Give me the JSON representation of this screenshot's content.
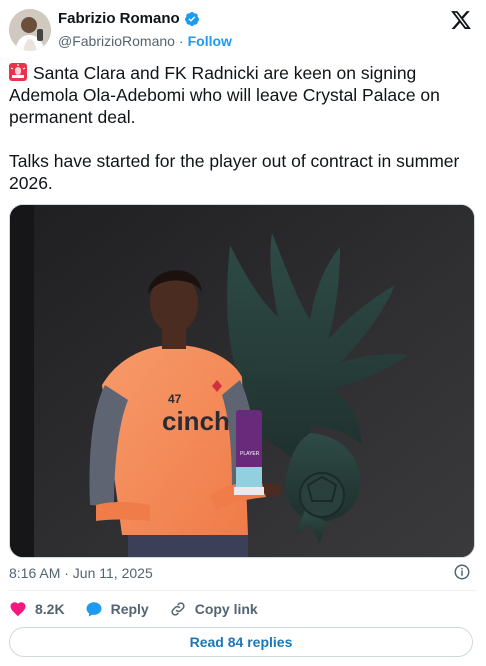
{
  "author": {
    "display_name": "Fabrizio Romano",
    "handle": "@FabrizioRomano",
    "separator": "·",
    "follow_label": "Follow"
  },
  "icons": {
    "verified": "verified-badge-icon",
    "brand": "x-logo-icon",
    "alert": "police-siren-emoji-icon",
    "info": "info-icon",
    "like": "heart-icon",
    "reply": "speech-bubble-icon",
    "copy": "link-icon"
  },
  "tweet": {
    "paragraph_1": "Santa Clara and FK Radnicki are keen on signing Ademola Ola-Adebomi who will leave Crystal Palace on permanent deal.",
    "paragraph_2": "Talks have started for the player out of contract in summer 2026."
  },
  "media": {
    "shirt_number": "47",
    "sponsor": "cinch",
    "trophy_label": "PLAYER"
  },
  "meta": {
    "timestamp": "8:16 AM · Jun 11, 2025"
  },
  "actions": {
    "likes_count": "8.2K",
    "reply_label": "Reply",
    "copy_link_label": "Copy link"
  },
  "footer": {
    "read_replies_label": "Read 84 replies"
  },
  "colors": {
    "accent": "#1d9bf0",
    "like": "#f91880",
    "shirt": "#f58a5a",
    "wall": "#2b2b2b"
  }
}
